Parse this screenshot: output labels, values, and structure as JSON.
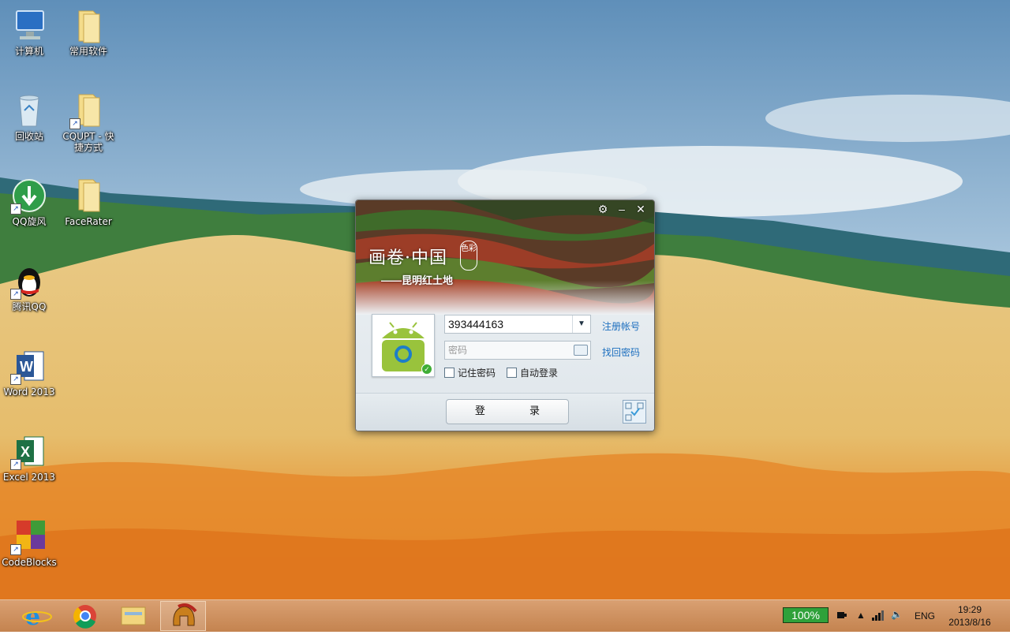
{
  "desktop": {
    "icons": [
      {
        "label": "计算机",
        "icon": "computer-icon"
      },
      {
        "label": "常用软件",
        "icon": "folder-icon"
      },
      {
        "label": "回收站",
        "icon": "recycle-bin-icon"
      },
      {
        "label": "CQUPT - 快捷方式",
        "icon": "folder-shortcut-icon"
      },
      {
        "label": "QQ旋风",
        "icon": "qq-whirlwind-icon"
      },
      {
        "label": "FaceRater",
        "icon": "folder-icon"
      },
      {
        "label": "腾讯QQ",
        "icon": "qq-penguin-icon"
      },
      {
        "label": "Word 2013",
        "icon": "word-icon"
      },
      {
        "label": "Excel 2013",
        "icon": "excel-icon"
      },
      {
        "label": "CodeBlocks",
        "icon": "codeblocks-icon"
      }
    ]
  },
  "qq_login": {
    "banner_title": "画卷·中国",
    "banner_subtitle": "——昆明红土地",
    "seal_text": "色彩",
    "settings_icon": "gear-icon",
    "minimize_label": "–",
    "close_label": "✕",
    "account_value": "393444163",
    "password_placeholder": "密码",
    "register_link": "注册帐号",
    "forgot_link": "找回密码",
    "remember_label": "记住密码",
    "autologin_label": "自动登录",
    "login_button": "登 录",
    "status": "online"
  },
  "taskbar": {
    "pinned": [
      "ie-icon",
      "chrome-icon",
      "file-explorer-icon",
      "spartan-helmet-app-icon"
    ],
    "battery": "100%",
    "language": "ENG",
    "time": "19:29",
    "date": "2013/8/16"
  }
}
